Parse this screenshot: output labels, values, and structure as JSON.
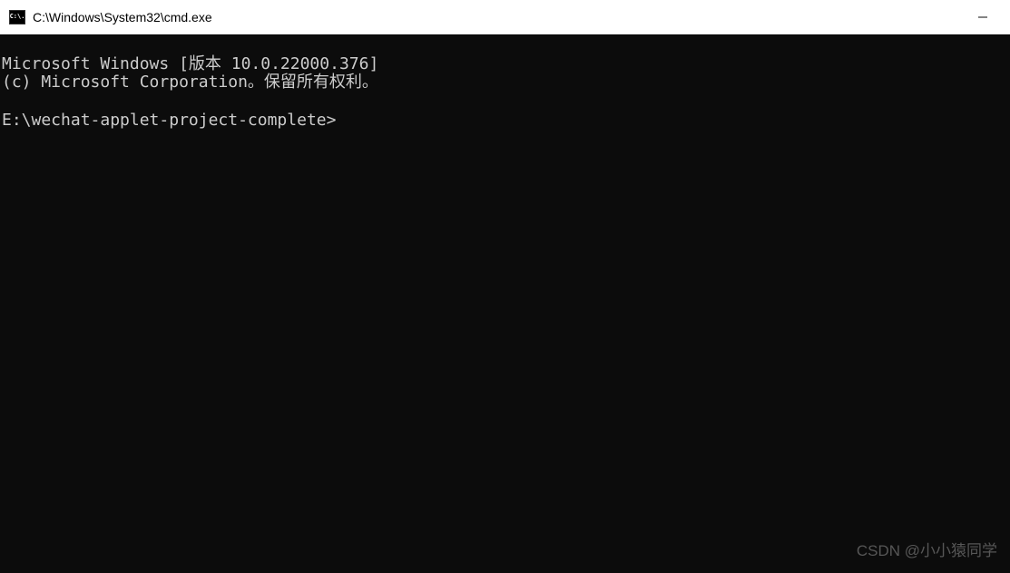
{
  "titlebar": {
    "icon_label": "C:\\.",
    "title": "C:\\Windows\\System32\\cmd.exe"
  },
  "terminal": {
    "line1": "Microsoft Windows [版本 10.0.22000.376]",
    "line2": "(c) Microsoft Corporation。保留所有权利。",
    "blank": "",
    "prompt": "E:\\wechat-applet-project-complete>"
  },
  "watermark": "CSDN @小小猿同学"
}
